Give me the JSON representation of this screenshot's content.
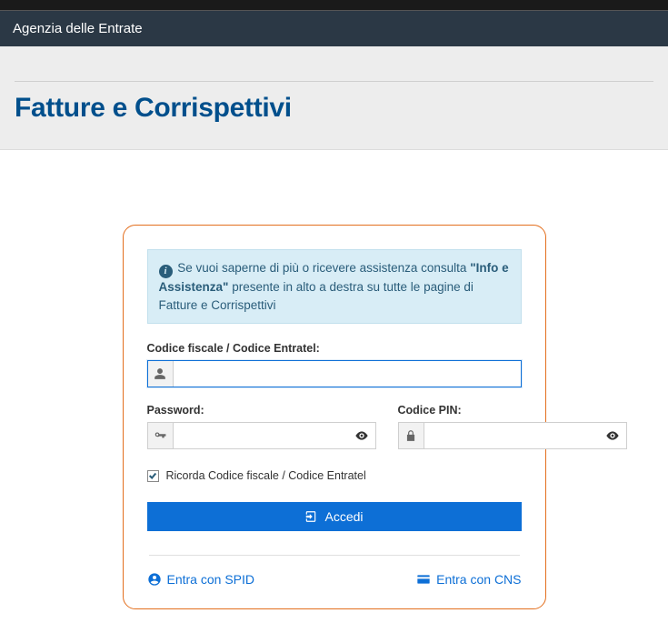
{
  "header": {
    "brand": "Agenzia delle Entrate"
  },
  "page": {
    "title": "Fatture e Corrispettivi"
  },
  "info": {
    "prefix": "Se vuoi saperne di più o ricevere assistenza consulta ",
    "bold": "\"Info e Assistenza\"",
    "suffix": " presente in alto a destra su tutte le pagine di Fatture e Corrispettivi"
  },
  "form": {
    "cf_label": "Codice fiscale / Codice Entratel:",
    "password_label": "Password:",
    "pin_label": "Codice PIN:",
    "remember_label": "Ricorda Codice fiscale / Codice Entratel",
    "remember_checked": true,
    "submit_label": "Accedi",
    "cf_value": "",
    "password_value": "",
    "pin_value": ""
  },
  "alt": {
    "spid_label": "Entra con SPID",
    "cns_label": "Entra con CNS"
  }
}
